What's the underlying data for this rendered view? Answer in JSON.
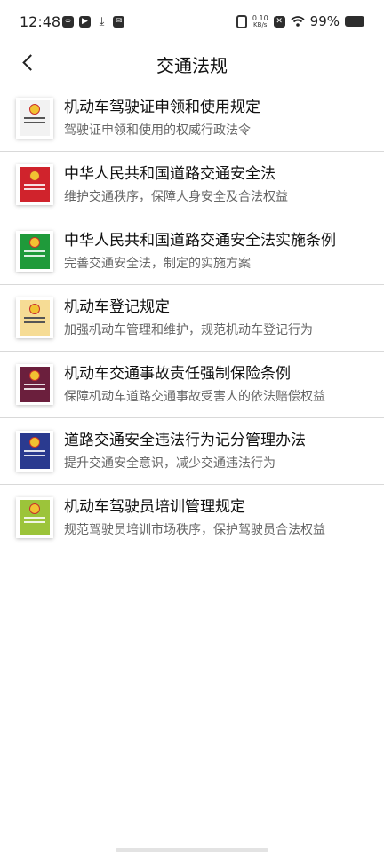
{
  "status_bar": {
    "time": "12:48",
    "left_icons": [
      "cloud-sync-icon",
      "play-store-icon",
      "download-icon",
      "message-icon"
    ],
    "net_speed_value": "0.10",
    "net_speed_unit": "KB/s",
    "battery_percent": "99%"
  },
  "nav": {
    "title": "交通法规"
  },
  "items": [
    {
      "title": "机动车驾驶证申领和使用规定",
      "desc": "驾驶证申领和使用的权威行政法令",
      "cover_color": "#f2f2f2"
    },
    {
      "title": "中华人民共和国道路交通安全法",
      "desc": "维护交通秩序，保障人身安全及合法权益",
      "cover_color": "#d0232c"
    },
    {
      "title": "中华人民共和国道路交通安全法实施条例",
      "desc": "完善交通安全法，制定的实施方案",
      "cover_color": "#1f9a3a"
    },
    {
      "title": "机动车登记规定",
      "desc": "加强机动车管理和维护，规范机动车登记行为",
      "cover_color": "#f6dc95"
    },
    {
      "title": "机动车交通事故责任强制保险条例",
      "desc": "保障机动车道路交通事故受害人的依法赔偿权益",
      "cover_color": "#6b1f3d"
    },
    {
      "title": "道路交通安全违法行为记分管理办法",
      "desc": "提升交通安全意识，减少交通违法行为",
      "cover_color": "#2a3a8f"
    },
    {
      "title": "机动车驾驶员培训管理规定",
      "desc": "规范驾驶员培训市场秩序，保护驾驶员合法权益",
      "cover_color": "#9cc43a"
    }
  ]
}
